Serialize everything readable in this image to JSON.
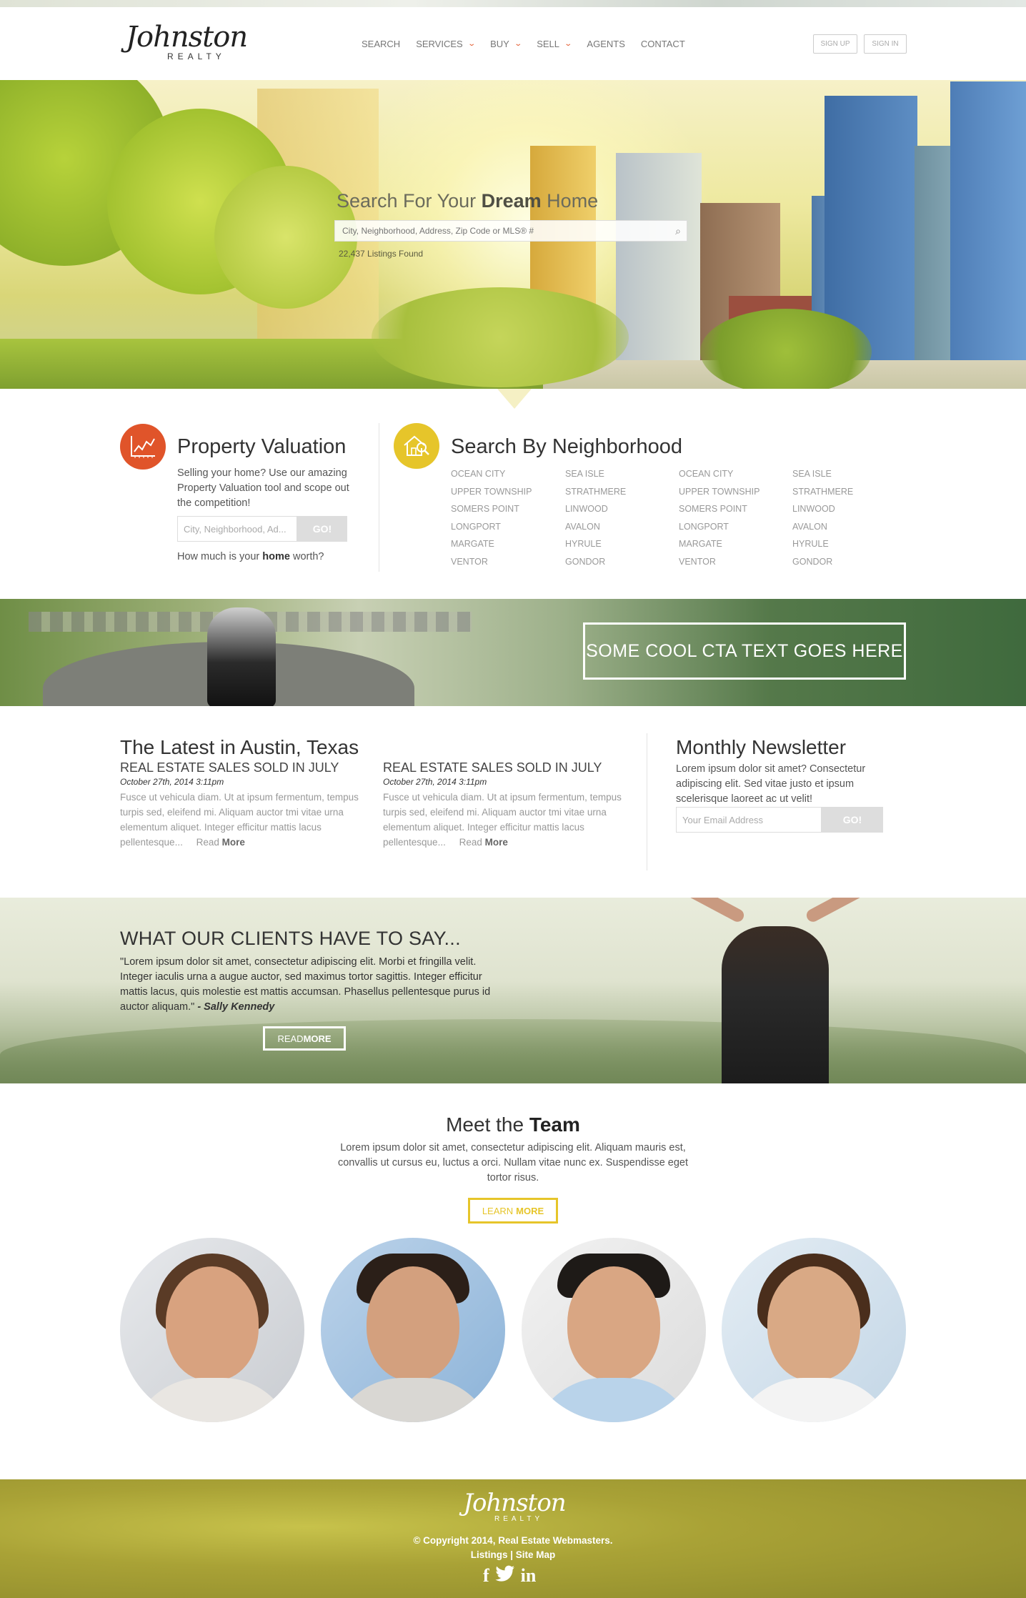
{
  "header": {
    "logo_script": "Johnston",
    "logo_sub": "REALTY",
    "nav": [
      {
        "label": "SEARCH",
        "dropdown": false
      },
      {
        "label": "SERVICES",
        "dropdown": true
      },
      {
        "label": "BUY",
        "dropdown": true
      },
      {
        "label": "SELL",
        "dropdown": true
      },
      {
        "label": "AGENTS",
        "dropdown": false
      },
      {
        "label": "CONTACT",
        "dropdown": false
      }
    ],
    "signup": "SIGN UP",
    "signin": "SIGN IN"
  },
  "hero": {
    "title_pre": "Search For Your ",
    "title_bold": "Dream",
    "title_post": " Home",
    "search_placeholder": "City, Neighborhood, Address, Zip Code or MLS® #",
    "listings": "22,437 Listings Found"
  },
  "valuation": {
    "title": "Property Valuation",
    "description": "Selling your home? Use our amazing Property Valuation tool and scope out the competition!",
    "placeholder": "City, Neighborhood, Ad...",
    "go": "GO!",
    "worth_pre": "How much is your ",
    "worth_bold": "home",
    "worth_post": " worth?"
  },
  "neighborhood": {
    "title": "Search By Neighborhood",
    "columns": [
      [
        "OCEAN CITY",
        "UPPER TOWNSHIP",
        "SOMERS POINT",
        "LONGPORT",
        "MARGATE",
        "VENTOR"
      ],
      [
        "SEA ISLE",
        "STRATHMERE",
        "LINWOOD",
        "AVALON",
        "HYRULE",
        "GONDOR"
      ],
      [
        "OCEAN CITY",
        "UPPER TOWNSHIP",
        "SOMERS POINT",
        "LONGPORT",
        "MARGATE",
        "VENTOR"
      ],
      [
        "SEA ISLE",
        "STRATHMERE",
        "LINWOOD",
        "AVALON",
        "HYRULE",
        "GONDOR"
      ]
    ]
  },
  "cta": {
    "label": "SOME COOL CTA TEXT GOES HERE"
  },
  "latest": {
    "title": "The Latest in Austin, Texas",
    "posts": [
      {
        "heading": "REAL ESTATE SALES SOLD IN JULY",
        "date": "October 27th, 2014 3:11pm",
        "body": "Fusce ut vehicula diam. Ut at ipsum fermentum, tempus turpis sed, eleifend mi. Aliquam auctor tmi vitae urna elementum aliquet. Integer efficitur mattis lacus pellentesque...",
        "read_pre": "Read ",
        "read_bold": "More"
      },
      {
        "heading": "REAL ESTATE SALES SOLD IN JULY",
        "date": "October 27th, 2014 3:11pm",
        "body": "Fusce ut vehicula diam. Ut at ipsum fermentum, tempus turpis sed, eleifend mi. Aliquam auctor tmi vitae urna elementum aliquet. Integer efficitur mattis lacus pellentesque...",
        "read_pre": "Read ",
        "read_bold": "More"
      }
    ]
  },
  "newsletter": {
    "title": "Monthly Newsletter",
    "description": "Lorem ipsum dolor sit amet? Consectetur adipiscing elit. Sed vitae justo et ipsum scelerisque laoreet ac ut velit!",
    "placeholder": "Your Email Address",
    "go": "GO!"
  },
  "testimonials": {
    "title": "WHAT OUR CLIENTS HAVE TO SAY...",
    "quote": "\"Lorem ipsum dolor sit amet, consectetur adipiscing elit. Morbi et fringilla velit. Integer iaculis urna a augue auctor, sed maximus tortor sagittis. Integer efficitur mattis lacus, quis molestie est mattis accumsan. Phasellus pellentesque purus id auctor aliquam.\"",
    "author": " - Sally Kennedy",
    "read_pre": "READ ",
    "read_bold": "MORE"
  },
  "team": {
    "title_pre": "Meet the ",
    "title_bold": "Team",
    "description": "Lorem ipsum dolor sit amet, consectetur adipiscing elit. Aliquam mauris est, convallis ut cursus eu, luctus a orci. Nullam vitae nunc ex. Suspendisse eget tortor risus.",
    "learn_pre": "LEARN",
    "learn_bold": "MORE"
  },
  "footer": {
    "logo_script": "Johnston",
    "logo_sub": "REALTY",
    "copyright": "© Copyright 2014, Real Estate Webmasters.",
    "links": "Listings | Site Map",
    "social": [
      "f",
      "t",
      "in"
    ]
  },
  "colors": {
    "accent_orange": "#e0542a",
    "accent_yellow": "#e6c52a",
    "footer_olive": "#a9a236"
  }
}
